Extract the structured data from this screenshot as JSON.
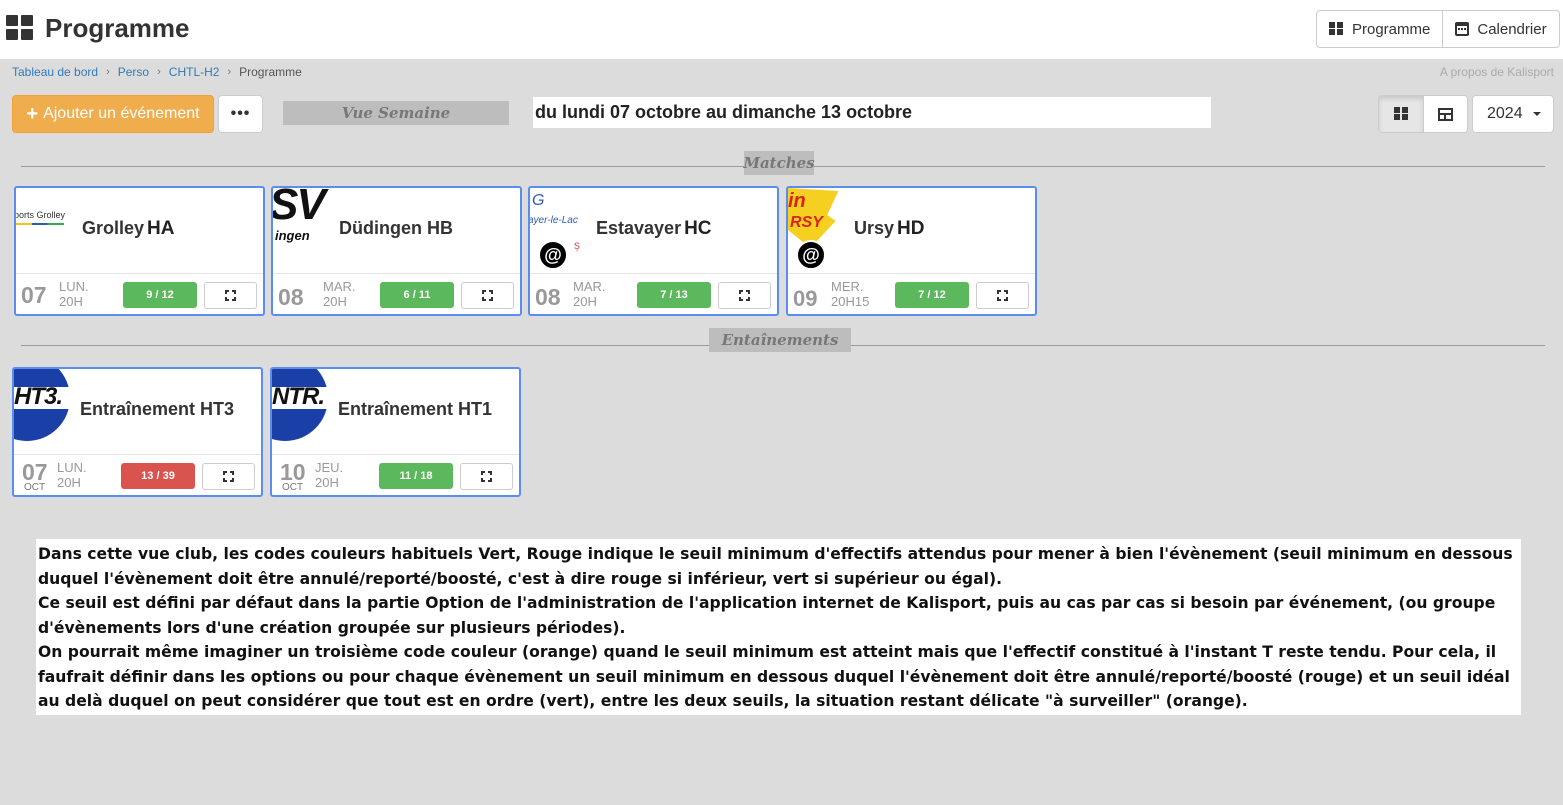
{
  "header": {
    "title": "Programme",
    "views": [
      {
        "label": "Programme",
        "icon": "grid-icon"
      },
      {
        "label": "Calendrier",
        "icon": "calendar-icon"
      }
    ]
  },
  "breadcrumb": [
    "Tableau de bord",
    "Perso",
    "CHTL-H2",
    "Programme"
  ],
  "about_link": "A propos de Kalisport",
  "toolbar": {
    "add_label": "Ajouter un événement",
    "more_label": "•••",
    "week_view_label": "Vue Semaine",
    "date_range": "du lundi 07 octobre au dimanche 13 octobre",
    "year": "2024"
  },
  "sections": {
    "matches": "Matches",
    "trainings": "Entaînements"
  },
  "matches": [
    {
      "team": "Grolley",
      "code": "HA",
      "day": "07",
      "weekday": "LUN.",
      "time": "20H",
      "count": "9 / 12",
      "status": "ok",
      "logo_text": "ports Grolley",
      "away": false
    },
    {
      "team": "Düdingen HB",
      "code": "",
      "day": "08",
      "weekday": "MAR.",
      "time": "20H",
      "count": "6 / 11",
      "status": "ok",
      "logo_text": "SV",
      "logo_sub": "ingen",
      "away": false
    },
    {
      "team": "Estavayer",
      "code": "HC",
      "day": "08",
      "weekday": "MAR.",
      "time": "20H",
      "count": "7 / 13",
      "status": "ok",
      "logo_text": "ayer-le-Lac",
      "away": true
    },
    {
      "team": "Ursy",
      "code": "HD",
      "day": "09",
      "weekday": "MER.",
      "time": "20H15",
      "count": "7 / 12",
      "status": "ok",
      "logo_text": "RSY",
      "away": true
    }
  ],
  "trainings": [
    {
      "team": "Entraînement HT3",
      "day": "07",
      "month": "OCT",
      "weekday": "LUN.",
      "time": "20H",
      "count": "13 / 39",
      "status": "low",
      "logo_text": "HT3."
    },
    {
      "team": "Entraînement HT1",
      "day": "10",
      "month": "OCT",
      "weekday": "JEU.",
      "time": "20H",
      "count": "11 / 18",
      "status": "ok",
      "logo_text": "NTR."
    }
  ],
  "notes": [
    "Dans cette vue club, les codes couleurs habituels Vert, Rouge indique le seuil minimum d'effectifs attendus pour mener à bien l'évènement (seuil minimum en dessous duquel l'évènement doit être annulé/reporté/boosté, c'est à dire rouge si inférieur, vert si supérieur ou égal).",
    "Ce seuil est défini par défaut dans la partie Option de l'administration de l'application internet de Kalisport, puis au cas par cas si besoin par événement, (ou groupe d'évènements lors d'une création groupée sur plusieurs périodes).",
    "On pourrait même imaginer un troisième code couleur (orange) quand le seuil minimum est atteint mais que l'effectif constitué à l'instant T reste tendu. Pour cela, il faufrait définir dans les options ou pour chaque évènement un seuil minimum en dessous duquel l'évènement doit être annulé/reporté/boosté (rouge) et un seuil idéal au delà duquel on peut considérer que tout est en ordre (vert), entre les deux seuils, la situation restant délicate \"à surveiller\" (orange)."
  ],
  "colors": {
    "accent": "#f0ad4e",
    "ok": "#5cb85c",
    "low": "#d9534f",
    "card_border": "#5b8def"
  }
}
